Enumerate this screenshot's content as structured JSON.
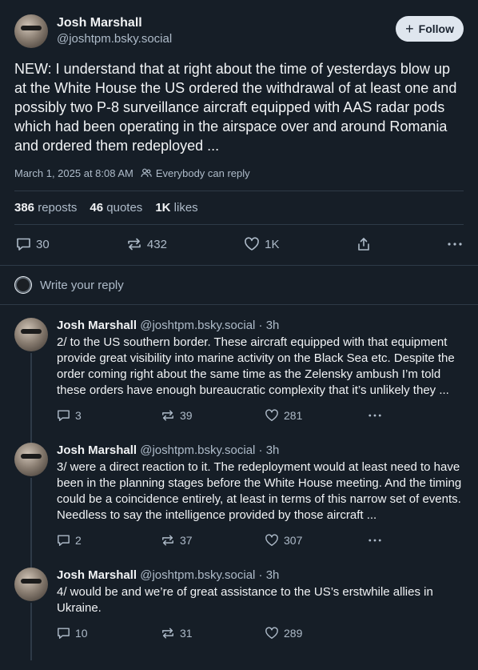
{
  "post": {
    "author_name": "Josh Marshall",
    "author_handle": "@joshtpm.bsky.social",
    "follow_label": "Follow",
    "text": "NEW: I understand that at right about the time of yesterdays blow up at the White House the US ordered the withdrawal of at least one and possibly two P-8 surveillance aircraft equipped with AAS radar pods which had been operating in the airspace over and around Romania and ordered them redeployed ...",
    "timestamp": "March 1, 2025 at 8:08 AM",
    "reply_permission": "Everybody can reply",
    "stats": {
      "reposts_count": "386",
      "reposts_label": "reposts",
      "quotes_count": "46",
      "quotes_label": "quotes",
      "likes_count": "1K",
      "likes_label": "likes"
    },
    "actions": {
      "replies": "30",
      "reposts": "432",
      "likes": "1K"
    }
  },
  "reply_box": {
    "placeholder": "Write your reply"
  },
  "thread": [
    {
      "name": "Josh Marshall",
      "handle_time": "@joshtpm.bsky.social · 3h",
      "text": "2/ to the US southern border. These aircraft equipped with that equipment provide great visibility into marine activity on the Black Sea etc. Despite the order coming right about the same time as the Zelensky ambush I’m told these orders have enough bureaucratic complexity that it’s unlikely they ...",
      "replies": "3",
      "reposts": "39",
      "likes": "281"
    },
    {
      "name": "Josh Marshall",
      "handle_time": "@joshtpm.bsky.social · 3h",
      "text": "3/ were a direct reaction to it. The redeployment would at least need to have been in the planning stages before the White House meeting. And the timing could be a coincidence entirely, at least in terms of this narrow set of events. Needless to say the intelligence provided by those aircraft ...",
      "replies": "2",
      "reposts": "37",
      "likes": "307"
    },
    {
      "name": "Josh Marshall",
      "handle_time": "@joshtpm.bsky.social · 3h",
      "text": "4/ would be and we’re of great assistance to the US’s erstwhile allies in Ukraine.",
      "replies": "10",
      "reposts": "31",
      "likes": "289"
    }
  ]
}
